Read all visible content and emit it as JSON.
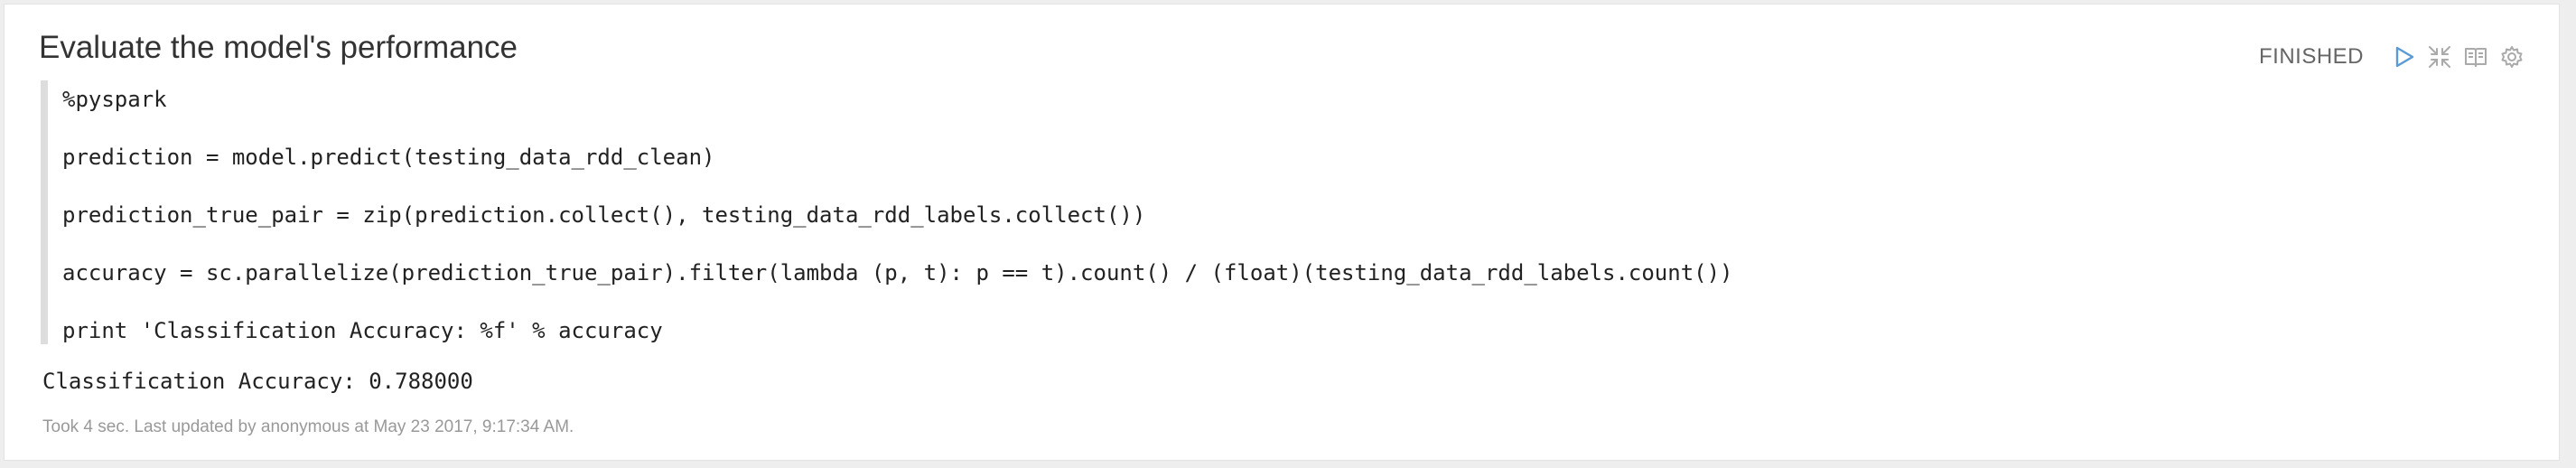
{
  "paragraph": {
    "title": "Evaluate the model's performance",
    "status": "FINISHED",
    "icons": [
      "run-play-icon",
      "collapse-arrows-icon",
      "book-icon",
      "gear-icon"
    ],
    "code_lines": [
      "%pyspark",
      "prediction = model.predict(testing_data_rdd_clean)",
      "prediction_true_pair = zip(prediction.collect(), testing_data_rdd_labels.collect())",
      "accuracy = sc.parallelize(prediction_true_pair).filter(lambda (p, t): p == t).count() / (float)(testing_data_rdd_labels.count())",
      "print 'Classification Accuracy: %f' % accuracy"
    ],
    "output": "Classification Accuracy: 0.788000",
    "footer": "Took 4 sec. Last updated by anonymous at May 23 2017, 9:17:34 AM.",
    "colors": {
      "run_icon": "#5b9bd5",
      "muted_icon": "#aaaaaa",
      "editor_border": "#dddddd"
    }
  }
}
